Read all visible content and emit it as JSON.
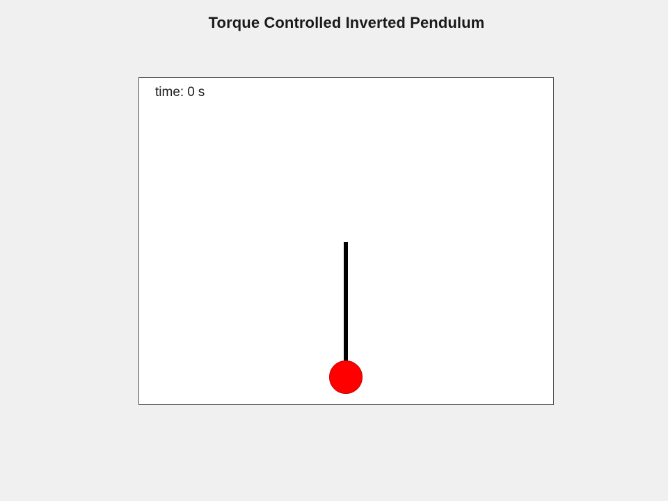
{
  "figure": {
    "title": "Torque Controlled Inverted Pendulum"
  },
  "readout": {
    "label": "time:",
    "value": "0",
    "unit": "s"
  },
  "colors": {
    "figure_background": "#f0f0f0",
    "axes_background": "#ffffff",
    "rod": "#000000",
    "bob": "#ff0000"
  }
}
